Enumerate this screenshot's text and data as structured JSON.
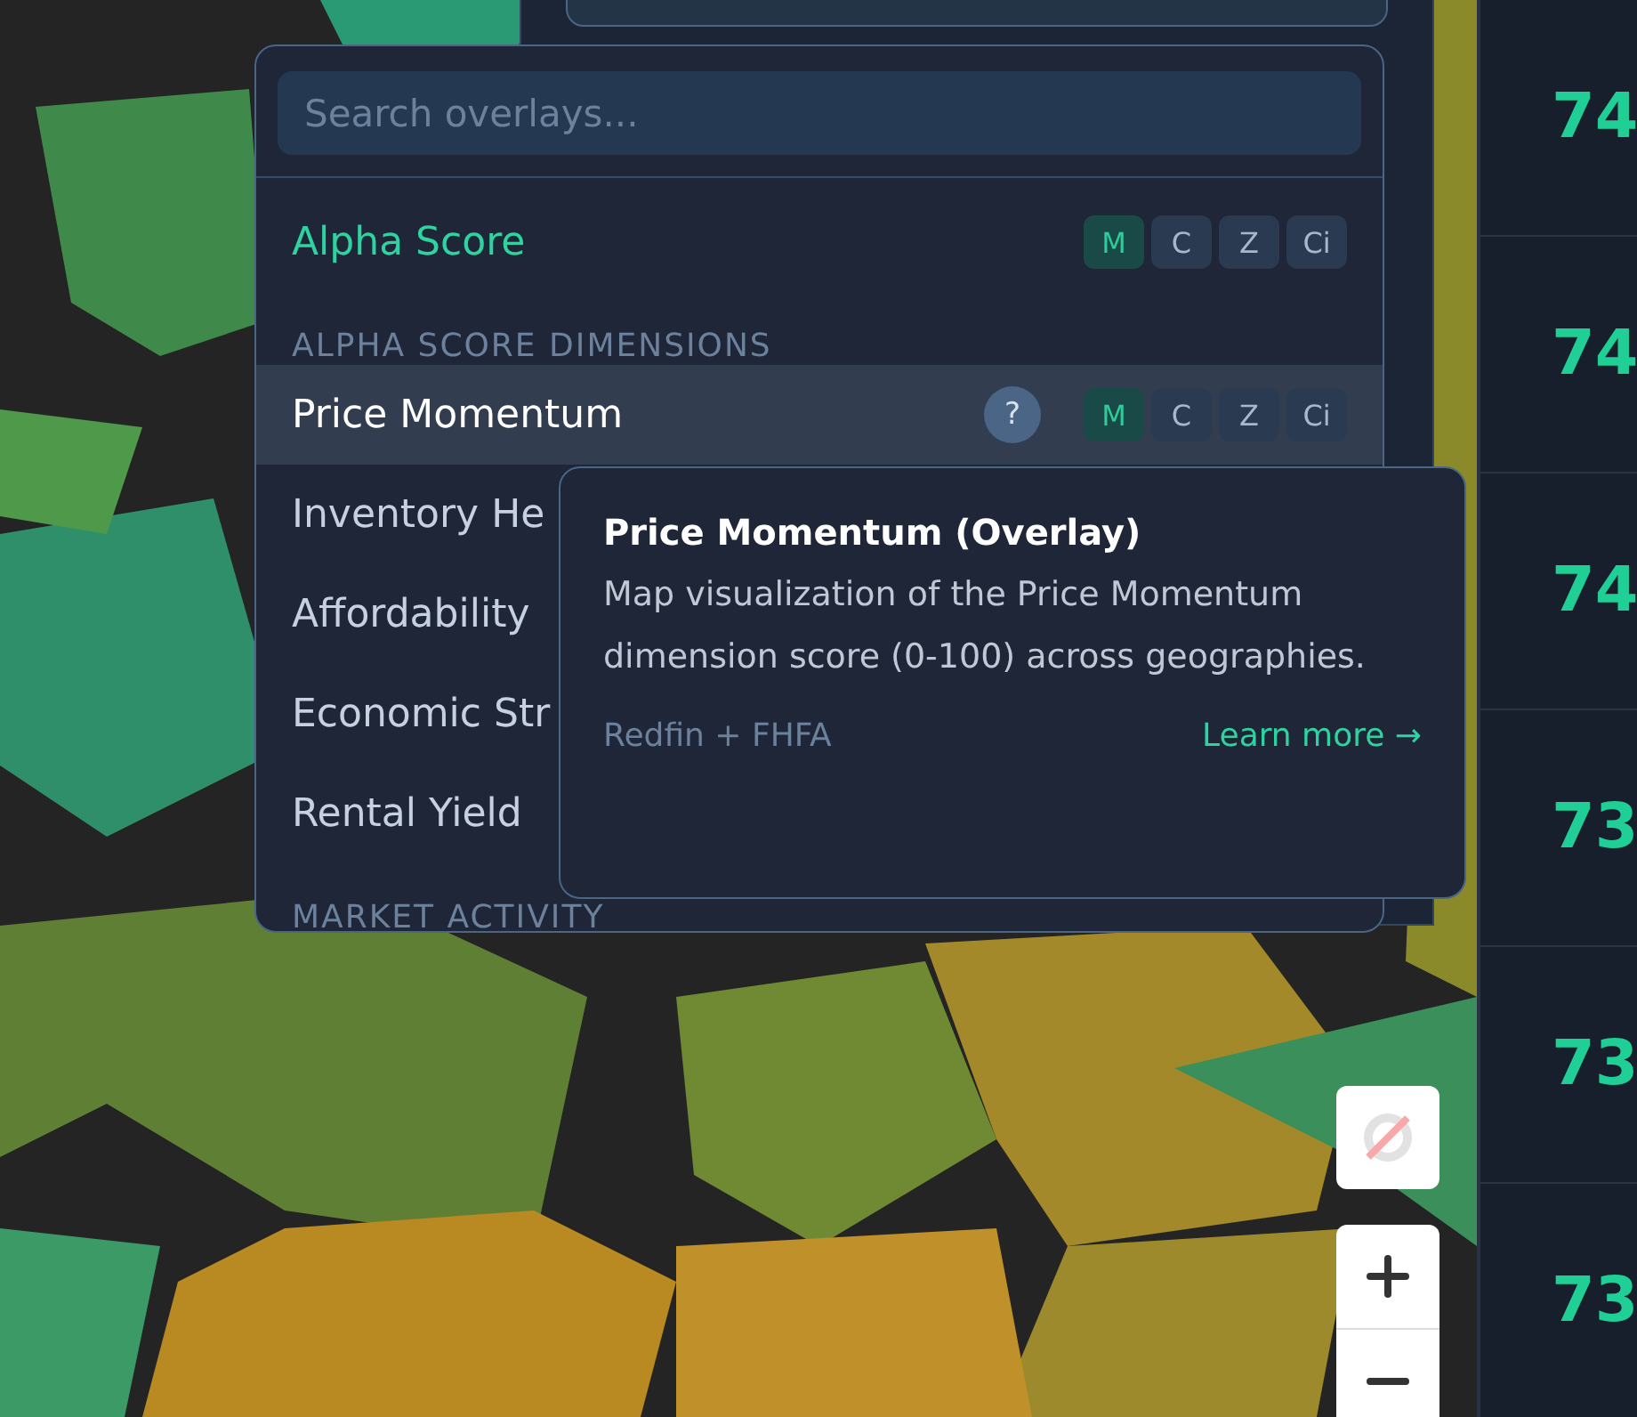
{
  "search": {
    "placeholder": "Search overlays..."
  },
  "overlays": [
    {
      "kind": "item",
      "label": "Alpha Score",
      "active": true,
      "hovered": false,
      "help": false,
      "modes": [
        {
          "label": "M",
          "selected": true
        },
        {
          "label": "C",
          "selected": false
        },
        {
          "label": "Z",
          "selected": false
        },
        {
          "label": "Ci",
          "selected": false
        }
      ]
    },
    {
      "kind": "header",
      "label": "ALPHA SCORE DIMENSIONS"
    },
    {
      "kind": "item",
      "label": "Price Momentum",
      "active": false,
      "hovered": true,
      "help": true,
      "help_label": "?",
      "modes": [
        {
          "label": "M",
          "selected": true
        },
        {
          "label": "C",
          "selected": false
        },
        {
          "label": "Z",
          "selected": false
        },
        {
          "label": "Ci",
          "selected": false
        }
      ]
    },
    {
      "kind": "item",
      "label": "Inventory He",
      "active": false,
      "hovered": false,
      "help": false
    },
    {
      "kind": "item",
      "label": "Affordability",
      "active": false,
      "hovered": false,
      "help": false
    },
    {
      "kind": "item",
      "label": "Economic Str",
      "active": false,
      "hovered": false,
      "help": false
    },
    {
      "kind": "item",
      "label": "Rental Yield",
      "active": false,
      "hovered": false,
      "help": false
    },
    {
      "kind": "header",
      "label": "MARKET ACTIVITY"
    }
  ],
  "tooltip": {
    "title": "Price Momentum (Overlay)",
    "description": "Map visualization of the Price Momentum dimension score (0-100) across geographies.",
    "source": "Redfin + FHFA",
    "link": "Learn more →"
  },
  "scores": [
    "74",
    "74",
    "74",
    "73",
    "73",
    "73"
  ]
}
